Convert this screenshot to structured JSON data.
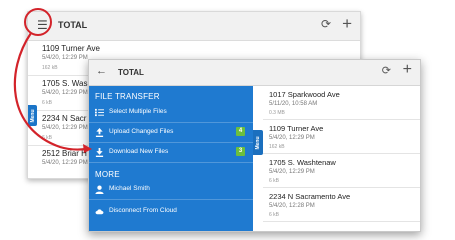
{
  "back_window": {
    "title": "TOTAL",
    "menu_tab_label": "Menu",
    "items": [
      {
        "name": "1109 Turner Ave",
        "date": "5/4/20, 12:29 PM",
        "size": "162 kB"
      },
      {
        "name": "1705 S. Was",
        "date": "5/4/20, 12:29 PM",
        "size": "6 kB"
      },
      {
        "name": "2234 N Sacr",
        "date": "5/4/20, 12:29 PM",
        "size": "6 kB"
      },
      {
        "name": "2512 Briar H",
        "date": "5/4/20, 12:29 PM",
        "size": ""
      }
    ]
  },
  "front_window": {
    "title": "TOTAL",
    "drawer": {
      "file_transfer_heading": "FILE TRANSFER",
      "items": [
        {
          "label": "Select Multiple Files",
          "icon": "checklist-icon",
          "badge": ""
        },
        {
          "label": "Upload Changed Files",
          "icon": "upload-icon",
          "badge": "4"
        },
        {
          "label": "Download New Files",
          "icon": "download-icon",
          "badge": "3"
        }
      ],
      "more_heading": "MORE",
      "user_label": "Michael Smith",
      "disconnect_label": "Disconnect From Cloud",
      "tab_label": "Menu"
    },
    "files": [
      {
        "name": "1017 Sparkwood Ave",
        "date": "5/11/20, 10:58 AM",
        "size": "0.3 MB"
      },
      {
        "name": "1109 Turner Ave",
        "date": "5/4/20, 12:29 PM",
        "size": "162 kB"
      },
      {
        "name": "1705 S. Washtenaw",
        "date": "5/4/20, 12:29 PM",
        "size": "6 kB"
      },
      {
        "name": "2234 N Sacramento Ave",
        "date": "5/4/20, 12:28 PM",
        "size": "6 kB"
      }
    ]
  },
  "colors": {
    "drawer_blue": "#1f7ad0",
    "badge_green": "#6cbf3d",
    "annotation_red": "#d3232a"
  }
}
